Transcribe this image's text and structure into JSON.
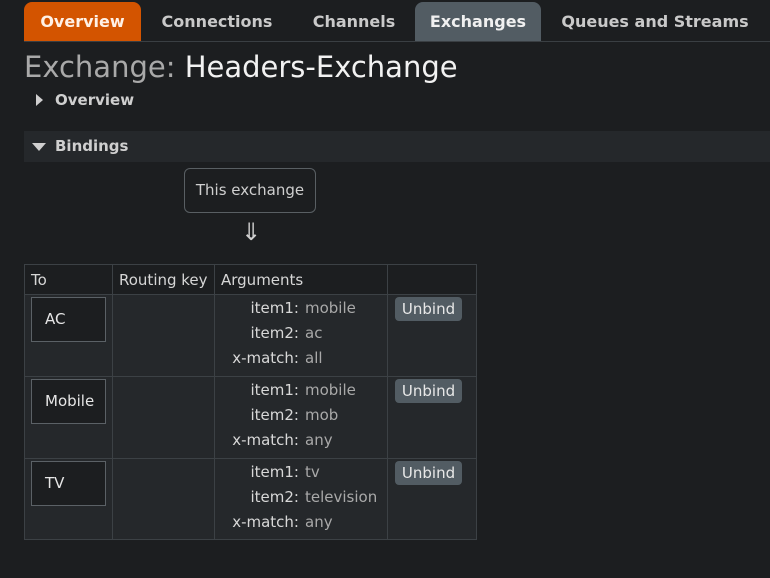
{
  "tabs": [
    {
      "label": "Overview",
      "state": "home"
    },
    {
      "label": "Connections",
      "state": "normal"
    },
    {
      "label": "Channels",
      "state": "normal"
    },
    {
      "label": "Exchanges",
      "state": "active"
    },
    {
      "label": "Queues and Streams",
      "state": "normal"
    }
  ],
  "page": {
    "title_label": "Exchange:",
    "title_value": "Headers-Exchange"
  },
  "sections": {
    "overview": {
      "label": "Overview",
      "expanded": false
    },
    "bindings": {
      "label": "Bindings",
      "expanded": true
    }
  },
  "bindings": {
    "source_label": "This exchange",
    "arrow": "⇓",
    "columns": [
      "To",
      "Routing key",
      "Arguments",
      ""
    ],
    "rows": [
      {
        "to": "AC",
        "routing_key": "",
        "args": [
          {
            "key": "item1:",
            "value": "mobile"
          },
          {
            "key": "item2:",
            "value": "ac"
          },
          {
            "key": "x-match:",
            "value": "all"
          }
        ],
        "action": "Unbind"
      },
      {
        "to": "Mobile",
        "routing_key": "",
        "args": [
          {
            "key": "item1:",
            "value": "mobile"
          },
          {
            "key": "item2:",
            "value": "mob"
          },
          {
            "key": "x-match:",
            "value": "any"
          }
        ],
        "action": "Unbind"
      },
      {
        "to": "TV",
        "routing_key": "",
        "args": [
          {
            "key": "item1:",
            "value": "tv"
          },
          {
            "key": "item2:",
            "value": "television"
          },
          {
            "key": "x-match:",
            "value": "any"
          }
        ],
        "action": "Unbind"
      }
    ]
  },
  "colors": {
    "accent": "#d35400",
    "active_tab": "#525c63",
    "background": "#1c1e20"
  }
}
